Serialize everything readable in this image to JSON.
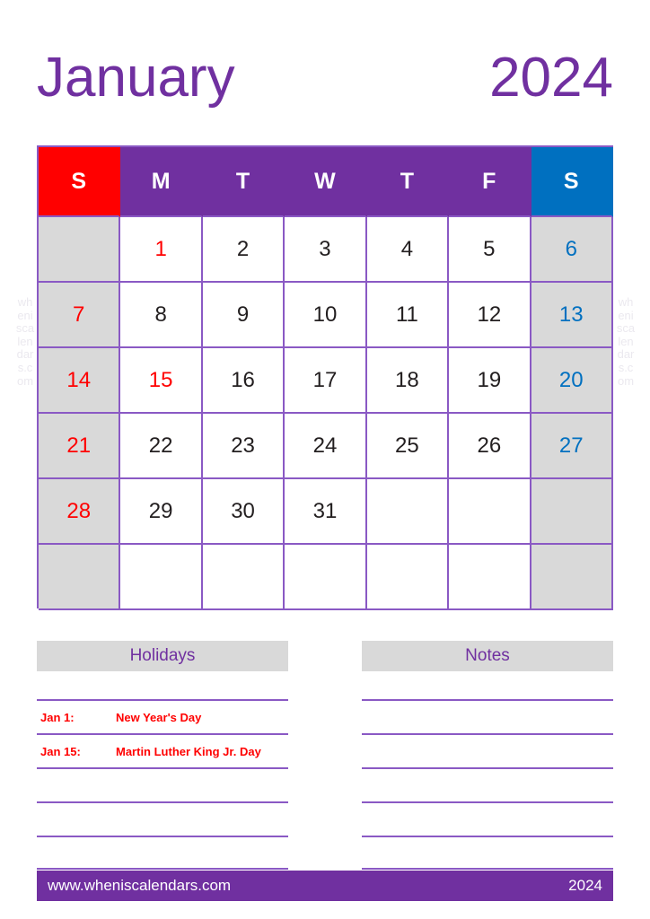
{
  "title": {
    "month": "January",
    "year": "2024"
  },
  "watermark": {
    "text": "wheniscalendars.com"
  },
  "calendar": {
    "weekday_headers": [
      {
        "label": "S",
        "kind": "sunday"
      },
      {
        "label": "M",
        "kind": "weekday"
      },
      {
        "label": "T",
        "kind": "weekday"
      },
      {
        "label": "W",
        "kind": "weekday"
      },
      {
        "label": "T",
        "kind": "weekday"
      },
      {
        "label": "F",
        "kind": "weekday"
      },
      {
        "label": "S",
        "kind": "saturday"
      }
    ],
    "weeks": [
      [
        {
          "day": ""
        },
        {
          "day": "1",
          "holiday": true
        },
        {
          "day": "2"
        },
        {
          "day": "3"
        },
        {
          "day": "4"
        },
        {
          "day": "5"
        },
        {
          "day": "6"
        }
      ],
      [
        {
          "day": "7"
        },
        {
          "day": "8"
        },
        {
          "day": "9"
        },
        {
          "day": "10"
        },
        {
          "day": "11"
        },
        {
          "day": "12"
        },
        {
          "day": "13"
        }
      ],
      [
        {
          "day": "14"
        },
        {
          "day": "15",
          "holiday": true
        },
        {
          "day": "16"
        },
        {
          "day": "17"
        },
        {
          "day": "18"
        },
        {
          "day": "19"
        },
        {
          "day": "20"
        }
      ],
      [
        {
          "day": "21"
        },
        {
          "day": "22"
        },
        {
          "day": "23"
        },
        {
          "day": "24"
        },
        {
          "day": "25"
        },
        {
          "day": "26"
        },
        {
          "day": "27"
        }
      ],
      [
        {
          "day": "28"
        },
        {
          "day": "29"
        },
        {
          "day": "30"
        },
        {
          "day": "31"
        },
        {
          "day": ""
        },
        {
          "day": ""
        },
        {
          "day": ""
        }
      ],
      [
        {
          "day": ""
        },
        {
          "day": ""
        },
        {
          "day": ""
        },
        {
          "day": ""
        },
        {
          "day": ""
        },
        {
          "day": ""
        },
        {
          "day": ""
        }
      ]
    ]
  },
  "holidays": {
    "heading": "Holidays",
    "rows": [
      {
        "date": "Jan 1:",
        "name": "New Year's Day"
      },
      {
        "date": "Jan 15:",
        "name": "Martin Luther King Jr. Day"
      },
      {
        "date": "",
        "name": ""
      },
      {
        "date": "",
        "name": ""
      },
      {
        "date": "",
        "name": ""
      }
    ]
  },
  "notes": {
    "heading": "Notes",
    "rows": [
      {
        "text": ""
      },
      {
        "text": ""
      },
      {
        "text": ""
      },
      {
        "text": ""
      },
      {
        "text": ""
      }
    ]
  },
  "footer": {
    "url": "www.wheniscalendars.com",
    "year": "2024"
  },
  "colors": {
    "purple": "#7030a0",
    "grid_line": "#8a59c4",
    "sunday_red": "#ff0000",
    "saturday_blue": "#0070c0",
    "weekend_fill": "#d9d9d9",
    "panel_head_fill": "#d9d9d9",
    "day_text": "#231f20"
  }
}
